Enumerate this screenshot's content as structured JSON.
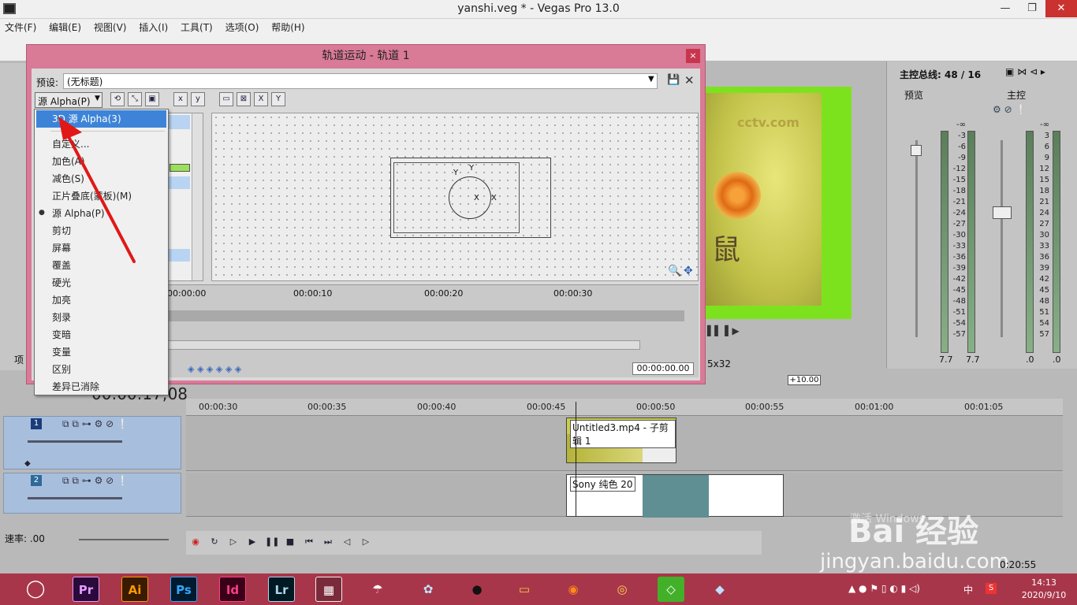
{
  "window": {
    "title": "yanshi.veg * - Vegas Pro 13.0",
    "menu": [
      "文件(F)",
      "编辑(E)",
      "视图(V)",
      "插入(I)",
      "工具(T)",
      "选项(O)",
      "帮助(H)"
    ]
  },
  "dialog": {
    "title": "轨道运动 - 轨道 1",
    "close": "×",
    "preset_label": "预设:",
    "preset_value": "(无标题)",
    "alpha_combo": "源 Alpha(P)",
    "timeline_ticks": [
      "00:00:00",
      "00:00:10",
      "00:00:20",
      "00:00:30"
    ],
    "time_display": "00:00:00.00",
    "canvas_labels": {
      "y1": "Y",
      "y2": "Y",
      "x1": "X",
      "x2": "X"
    }
  },
  "dropdown": {
    "items": [
      {
        "label": "3D 源 Alpha(3)",
        "selected": true
      },
      {
        "label": "自定义...",
        "selected": false
      },
      {
        "label": "加色(A)",
        "selected": false
      },
      {
        "label": "减色(S)",
        "selected": false
      },
      {
        "label": "正片叠底(蒙板)(M)",
        "selected": false
      },
      {
        "label": "源 Alpha(P)",
        "selected": false,
        "checked": true
      },
      {
        "label": "剪切",
        "selected": false
      },
      {
        "label": "屏幕",
        "selected": false
      },
      {
        "label": "覆盖",
        "selected": false
      },
      {
        "label": "硬光",
        "selected": false
      },
      {
        "label": "加亮",
        "selected": false
      },
      {
        "label": "刻录",
        "selected": false
      },
      {
        "label": "变暗",
        "selected": false
      },
      {
        "label": "变量",
        "selected": false
      },
      {
        "label": "区别",
        "selected": false
      },
      {
        "label": "差异已消除",
        "selected": false
      }
    ]
  },
  "master": {
    "title": "主控总线: 48 / 16",
    "preview_label": "预览",
    "main_label": "主控",
    "scale": [
      "-∞",
      "3",
      "6",
      "9",
      "12",
      "15",
      "18",
      "21",
      "24",
      "27",
      "30",
      "33",
      "36",
      "39",
      "42",
      "45",
      "48",
      "51",
      "54",
      "57"
    ],
    "scale_left": [
      "-∞",
      "-3",
      "-6",
      "-9",
      "-12",
      "-15",
      "-18",
      "-21",
      "-24",
      "-27",
      "-30",
      "-33",
      "-36",
      "-39",
      "-42",
      "-45",
      "-48",
      "-51",
      "-54",
      "-57"
    ],
    "bottom_left": [
      "7.7",
      "7.7"
    ],
    "bottom_right": [
      ".0",
      ".0"
    ]
  },
  "preview": {
    "size_label": "5x32",
    "zoom_value": "+10.00",
    "image_text": "鼠"
  },
  "timeline": {
    "current_time": "00:00:17;08",
    "ticks": [
      "00:00:30",
      "00:00:35",
      "00:00:40",
      "00:00:45",
      "00:00:50",
      "00:00:55",
      "00:01:00",
      "00:01:05"
    ],
    "tracks": [
      {
        "number": "1",
        "clip": "Untitled3.mp4 - 子剪辑 1"
      },
      {
        "number": "2",
        "clip": "Sony 纯色 20"
      }
    ],
    "rate_label": "速率: .00",
    "end_time": "0:20:55"
  },
  "taskbar": {
    "apps": [
      "Pr",
      "Ai",
      "Ps",
      "Id",
      "Lr"
    ],
    "time": "14:13",
    "date": "2020/9/10",
    "ime": "中"
  },
  "watermark": {
    "brand": "Bai 经验",
    "url": "jingyan.baidu.com",
    "activate_text": "激活 Windows"
  }
}
